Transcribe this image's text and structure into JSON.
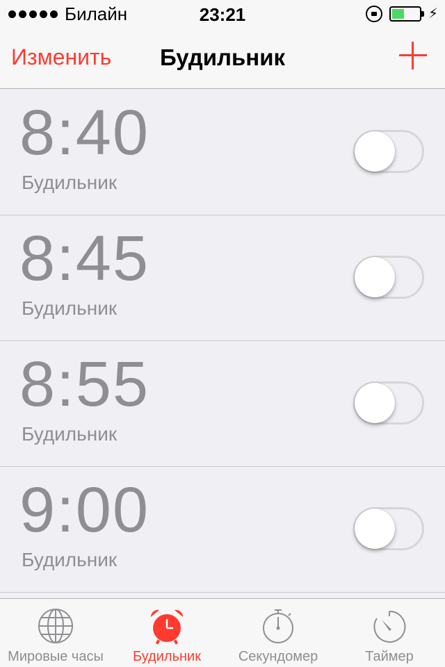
{
  "status_bar": {
    "carrier": "Билайн",
    "time": "23:21",
    "battery_level": 0.45,
    "battery_color": "#4cd964"
  },
  "nav": {
    "edit_label": "Изменить",
    "title": "Будильник",
    "add_icon": "plus-icon"
  },
  "alarms": [
    {
      "time": "8:40",
      "label": "Будильник",
      "enabled": false
    },
    {
      "time": "8:45",
      "label": "Будильник",
      "enabled": false
    },
    {
      "time": "8:55",
      "label": "Будильник",
      "enabled": false
    },
    {
      "time": "9:00",
      "label": "Будильник",
      "enabled": false
    }
  ],
  "tabs": [
    {
      "label": "Мировые часы",
      "icon": "globe-icon",
      "active": false
    },
    {
      "label": "Будильник",
      "icon": "alarm-clock-icon",
      "active": true
    },
    {
      "label": "Секундомер",
      "icon": "stopwatch-icon",
      "active": false
    },
    {
      "label": "Таймер",
      "icon": "timer-icon",
      "active": false
    }
  ],
  "colors": {
    "accent": "#ff3b30",
    "inactive": "#8e8e93",
    "background": "#efeff4"
  }
}
